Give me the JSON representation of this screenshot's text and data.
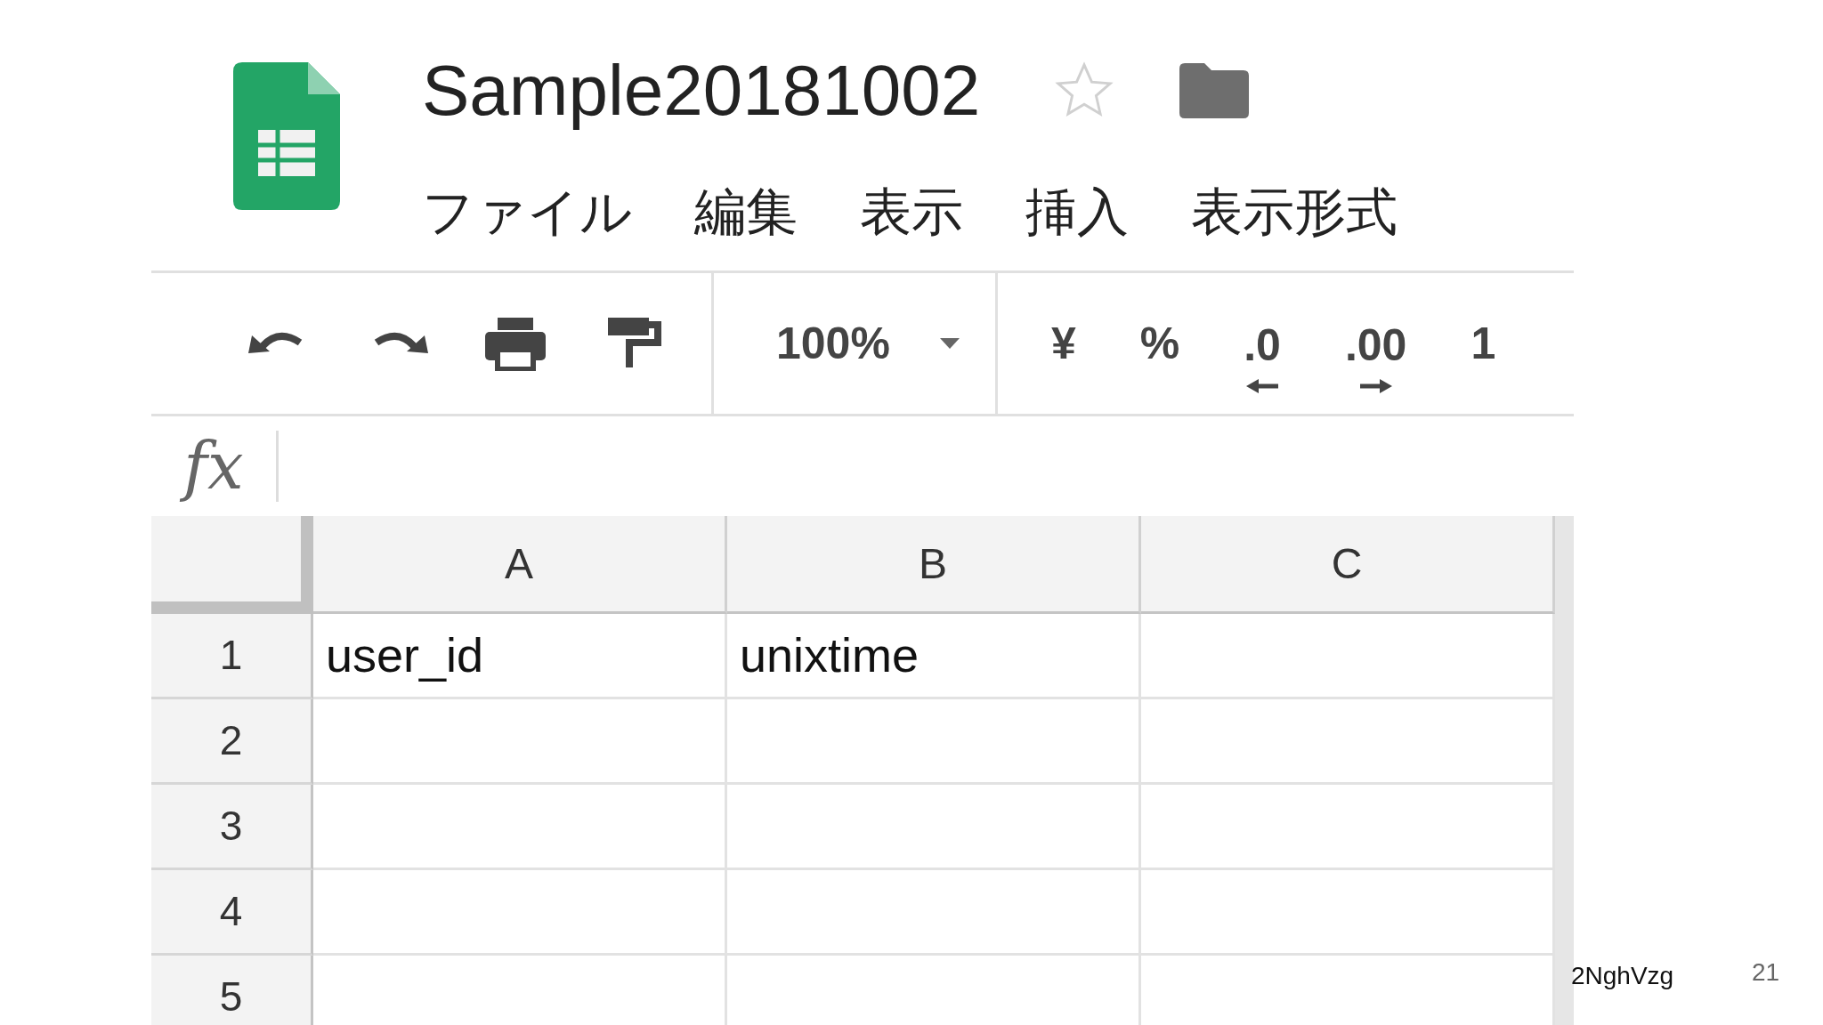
{
  "document": {
    "title": "Sample20181002",
    "starred": false
  },
  "menu": [
    {
      "label": "ファイル"
    },
    {
      "label": "編集"
    },
    {
      "label": "表示"
    },
    {
      "label": "挿入"
    },
    {
      "label": "表示形式"
    }
  ],
  "toolbar": {
    "tools": [
      {
        "kind": "undo"
      },
      {
        "kind": "redo"
      },
      {
        "kind": "print"
      },
      {
        "kind": "paint-format"
      }
    ],
    "zoom": "100%",
    "formats": [
      {
        "kind": "text",
        "label": "¥"
      },
      {
        "kind": "text",
        "label": "%"
      },
      {
        "kind": "decrease-decimal",
        "label": ".0"
      },
      {
        "kind": "increase-decimal",
        "label": ".00"
      },
      {
        "kind": "text",
        "label": "1"
      }
    ]
  },
  "formula_bar": {
    "label": "fx"
  },
  "sheet": {
    "columns": [
      "A",
      "B",
      "C"
    ],
    "rows": [
      {
        "number": "1",
        "cells": [
          "user_id",
          "unixtime"
        ]
      },
      {
        "number": "2"
      },
      {
        "number": "3"
      },
      {
        "number": "4"
      },
      {
        "number": "5"
      }
    ]
  },
  "slide_footer": {
    "code": "2NghVzg",
    "page": "21"
  }
}
